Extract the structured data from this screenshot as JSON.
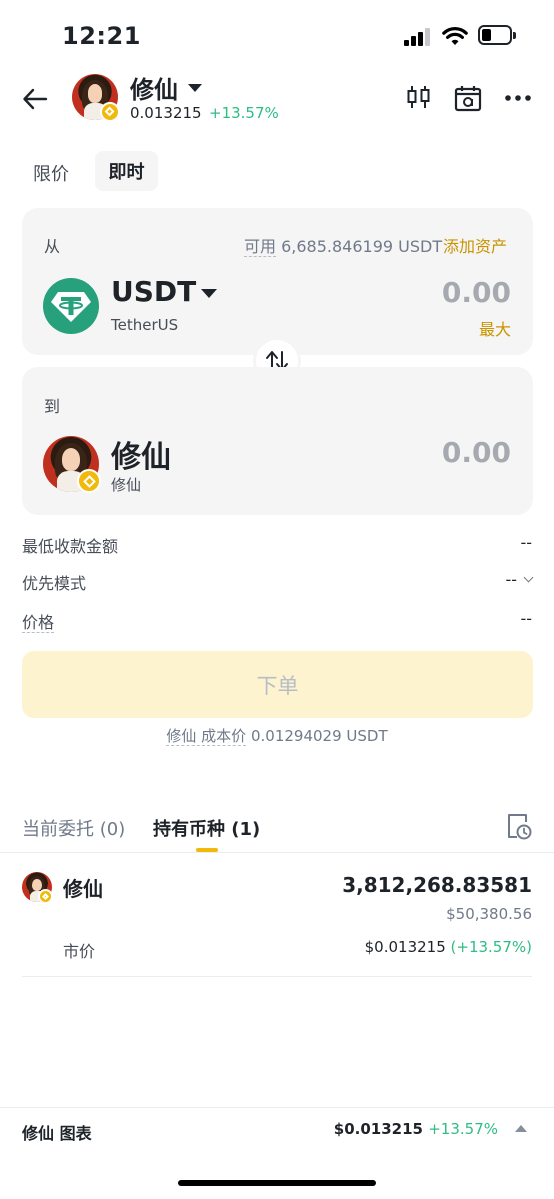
{
  "status_bar": {
    "time": "12:21"
  },
  "header": {
    "token_name": "修仙",
    "price": "0.013215",
    "change": "+13.57%",
    "icons": [
      "back-arrow-icon",
      "candlestick-chart-icon",
      "calendar-alert-icon",
      "more-icon"
    ]
  },
  "mode_tabs": {
    "limit": "限价",
    "instant": "即时",
    "active": "instant"
  },
  "from": {
    "label": "从",
    "available_label": "可用",
    "available_value": "6,685.846199 USDT",
    "add_asset": "添加资产",
    "symbol": "USDT",
    "full_name": "TetherUS",
    "amount": "0.00",
    "max": "最大"
  },
  "to": {
    "label": "到",
    "symbol": "修仙",
    "full_name": "修仙",
    "amount": "0.00"
  },
  "info": {
    "min_receive_label": "最低收款金额",
    "min_receive_value": "--",
    "priority_label": "优先模式",
    "priority_value": "--",
    "price_label": "价格",
    "price_value": "--"
  },
  "order_button": "下单",
  "cost": {
    "token": "修仙",
    "label": "成本价",
    "value": "0.01294029 USDT"
  },
  "holdings_tabs": {
    "open_orders": "当前委托 (0)",
    "holdings": "持有币种 (1)",
    "active": "holdings"
  },
  "holding": {
    "name": "修仙",
    "quantity": "3,812,268.83581",
    "usd_value": "$50,380.56",
    "market_label": "市价",
    "market_price": "$0.013215",
    "market_change": "(+13.57%)"
  },
  "bottom_bar": {
    "title": "修仙 图表",
    "price": "$0.013215",
    "change": "+13.57%"
  },
  "colors": {
    "accent": "#f0b90b",
    "positive": "#2ebd85",
    "link": "#c99400",
    "usdt": "#26a17b"
  }
}
